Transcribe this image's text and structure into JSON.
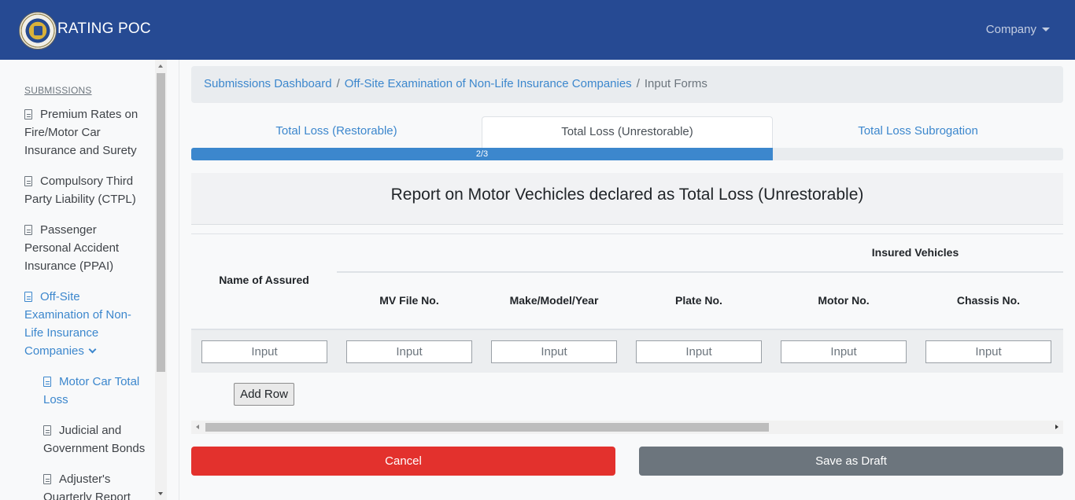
{
  "navbar": {
    "brand": "RATING POC",
    "company_menu": "Company"
  },
  "sidebar": {
    "heading": "SUBMISSIONS",
    "items": [
      {
        "label_lines": [
          "Premium Rates on",
          "Fire/Motor Car",
          "Insurance and Surety"
        ]
      },
      {
        "label_lines": [
          "Compulsory Third",
          "Party Liability (CTPL)"
        ]
      },
      {
        "label_lines": [
          "Passenger",
          "Personal Accident",
          "Insurance (PPAI)"
        ]
      },
      {
        "label_lines": [
          "Off-Site",
          "Examination of Non-",
          "Life Insurance",
          "Companies"
        ]
      },
      {
        "label_lines": [
          "Motor Car Total",
          "Loss"
        ]
      },
      {
        "label_lines": [
          "Judicial and",
          "Government Bonds"
        ]
      },
      {
        "label_lines": [
          "Adjuster's",
          "Quarterly Report"
        ]
      }
    ]
  },
  "breadcrumb": {
    "items": [
      "Submissions Dashboard",
      "Off-Site Examination of Non-Life Insurance Companies"
    ],
    "separator": "/",
    "current": "Input Forms"
  },
  "tabs": [
    {
      "label": "Total Loss (Restorable)"
    },
    {
      "label": "Total Loss (Unrestorable)"
    },
    {
      "label": "Total Loss Subrogation"
    }
  ],
  "progress": {
    "label": "2/3",
    "fraction": 0.667
  },
  "form": {
    "title": "Report on Motor Vechicles declared as Total Loss (Unrestorable)",
    "headers": {
      "name_of_assured": "Name of Assured",
      "group": "Insured Vehicles",
      "columns": [
        "MV File No.",
        "Make/Model/Year",
        "Plate No.",
        "Motor No.",
        "Chassis No."
      ]
    },
    "input_placeholder": "Input",
    "add_row": "Add Row"
  },
  "actions": {
    "cancel": "Cancel",
    "save_draft": "Save as Draft"
  },
  "colors": {
    "navbar": "#264a93",
    "link": "#3c87cd",
    "cancel": "#e3312d",
    "draft": "#6c757d"
  }
}
